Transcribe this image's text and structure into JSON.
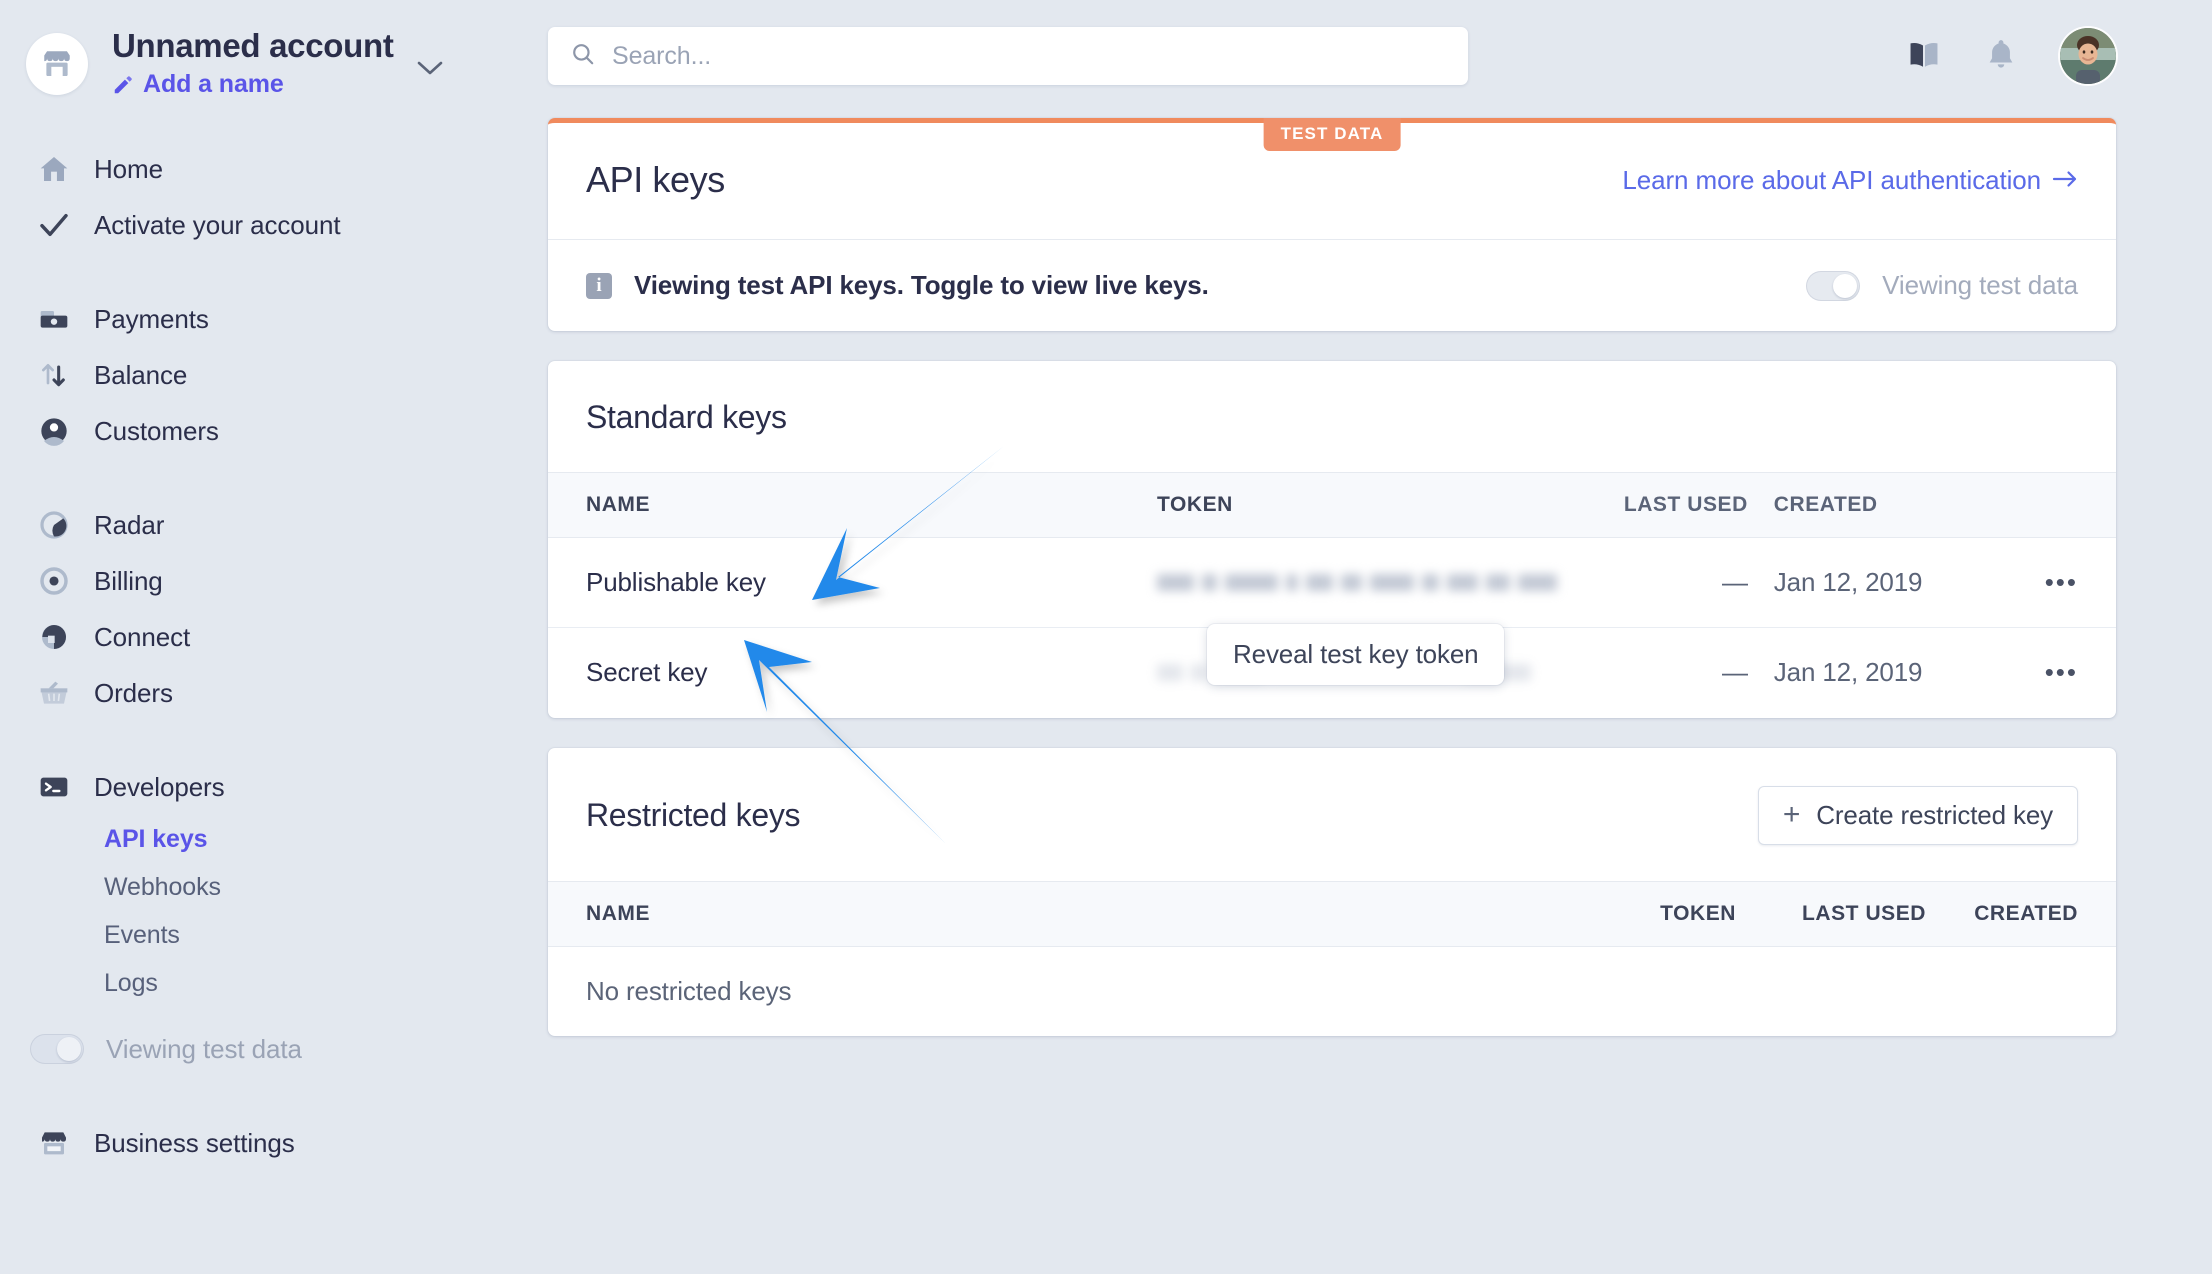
{
  "account": {
    "name": "Unnamed account",
    "add_name_label": "Add a name",
    "logo_icon": "storefront-icon",
    "chevron_icon": "chevron-down-icon",
    "pencil_icon": "pencil-icon"
  },
  "sidebar": {
    "groups": [
      {
        "items": [
          {
            "label": "Home",
            "icon": "home-icon"
          },
          {
            "label": "Activate your account",
            "icon": "check-icon"
          }
        ]
      },
      {
        "items": [
          {
            "label": "Payments",
            "icon": "payments-icon"
          },
          {
            "label": "Balance",
            "icon": "balance-arrows-icon"
          },
          {
            "label": "Customers",
            "icon": "customers-icon"
          }
        ]
      },
      {
        "items": [
          {
            "label": "Radar",
            "icon": "radar-icon"
          },
          {
            "label": "Billing",
            "icon": "billing-icon"
          },
          {
            "label": "Connect",
            "icon": "connect-icon"
          },
          {
            "label": "Orders",
            "icon": "orders-basket-icon"
          }
        ]
      }
    ],
    "developers": {
      "label": "Developers",
      "icon": "terminal-icon",
      "sub_items": [
        {
          "label": "API keys",
          "active": true
        },
        {
          "label": "Webhooks",
          "active": false
        },
        {
          "label": "Events",
          "active": false
        },
        {
          "label": "Logs",
          "active": false
        }
      ]
    },
    "test_toggle": {
      "label": "Viewing test data",
      "on": true
    },
    "business_settings": {
      "label": "Business settings",
      "icon": "storefront-icon"
    }
  },
  "topbar": {
    "search": {
      "placeholder": "Search...",
      "value": "",
      "icon": "search-icon"
    },
    "docs_icon": "book-icon",
    "notifications_icon": "bell-icon",
    "avatar": "user-avatar"
  },
  "api_card": {
    "badge": "TEST DATA",
    "title": "API keys",
    "link": "Learn more about API authentication",
    "link_arrow": "arrow-right-icon",
    "notice_icon": "info-icon",
    "notice_text": "Viewing test API keys. Toggle to view live keys.",
    "toggle_label": "Viewing test data",
    "toggle_on": true,
    "accent_color": "#F0906A"
  },
  "standard_keys": {
    "title": "Standard keys",
    "columns": [
      "NAME",
      "TOKEN",
      "LAST USED",
      "CREATED"
    ],
    "rows": [
      {
        "name": "Publishable key",
        "token": "",
        "token_hidden": true,
        "last_used": "—",
        "created": "Jan 12, 2019",
        "menu": "•••"
      },
      {
        "name": "Secret key",
        "token": "",
        "token_hidden": true,
        "last_used": "—",
        "created": "Jan 12, 2019",
        "menu": "•••"
      }
    ],
    "tooltip": "Reveal test key token"
  },
  "restricted_keys": {
    "title": "Restricted keys",
    "create_button": "Create restricted key",
    "create_icon": "plus-icon",
    "columns": [
      "NAME",
      "TOKEN",
      "LAST USED",
      "CREATED"
    ],
    "empty_text": "No restricted keys"
  },
  "annotations": {
    "arrow_color": "#2189EA",
    "arrows": [
      {
        "name": "arrow-pointing-publishable-key"
      },
      {
        "name": "arrow-pointing-secret-key"
      }
    ]
  }
}
